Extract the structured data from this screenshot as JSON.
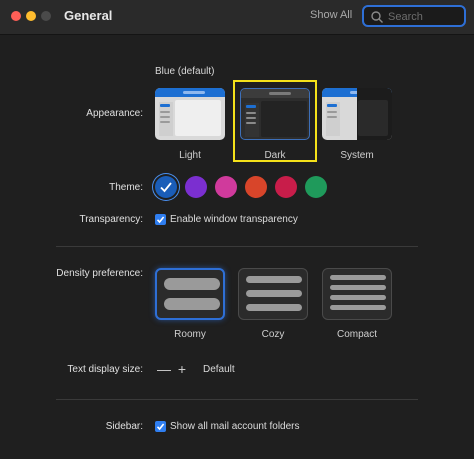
{
  "window": {
    "title": "General"
  },
  "toolbar": {
    "show_all": "Show All",
    "search_placeholder": "Search"
  },
  "appearance": {
    "label": "Appearance:",
    "header": "Blue (default)",
    "options": [
      {
        "name": "Light",
        "selected": false
      },
      {
        "name": "Dark",
        "selected": true
      },
      {
        "name": "System",
        "selected": false
      }
    ],
    "highlight_color": "#f5e21a"
  },
  "theme": {
    "label": "Theme:",
    "colors": [
      "#1a5db8",
      "#7b2fd0",
      "#d03a9c",
      "#d8452a",
      "#c81d4a",
      "#1f9a5b"
    ],
    "selected_index": 0
  },
  "transparency": {
    "label": "Transparency:",
    "checkbox_label": "Enable window transparency",
    "checked": true
  },
  "density": {
    "label": "Density preference:",
    "options": [
      {
        "name": "Roomy",
        "selected": true
      },
      {
        "name": "Cozy",
        "selected": false
      },
      {
        "name": "Compact",
        "selected": false
      }
    ]
  },
  "text_size": {
    "label": "Text display size:",
    "value": "Default",
    "decrease": "—",
    "increase": "+"
  },
  "sidebar": {
    "label": "Sidebar:",
    "checkbox_label": "Show all mail account folders",
    "checked": true
  },
  "accent_color": "#2e6fd6"
}
